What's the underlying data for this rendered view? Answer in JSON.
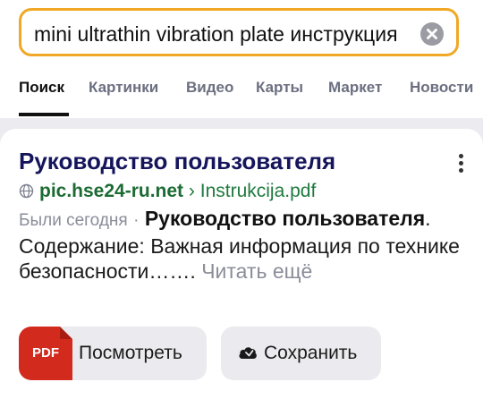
{
  "search": {
    "query": "mini ultrathin vibration plate инструкция",
    "clear_icon": "close-circle-icon"
  },
  "tabs": [
    {
      "label": "Поиск",
      "active": true
    },
    {
      "label": "Картинки"
    },
    {
      "label": "Видео"
    },
    {
      "label": "Карты"
    },
    {
      "label": "Маркет"
    },
    {
      "label": "Новости"
    }
  ],
  "result": {
    "title": "Руководство пользователя",
    "domain": "pic.hse24-ru.net",
    "separator": "›",
    "path": "Instrukcija.pdf",
    "visited": "Были сегодня",
    "dot": "·",
    "snippet_bold": "Руководство пользователя",
    "snippet_text": ". Содержание: Важная информация по технике безопасности…….",
    "read_more": "Читать ещё",
    "file_badge": "PDF",
    "view_button": "Посмотреть",
    "save_button": "Сохранить"
  },
  "colors": {
    "search_border": "#f0a826",
    "title": "#15155c",
    "url": "#1f7a3e",
    "pdf_badge": "#d32a1e"
  }
}
